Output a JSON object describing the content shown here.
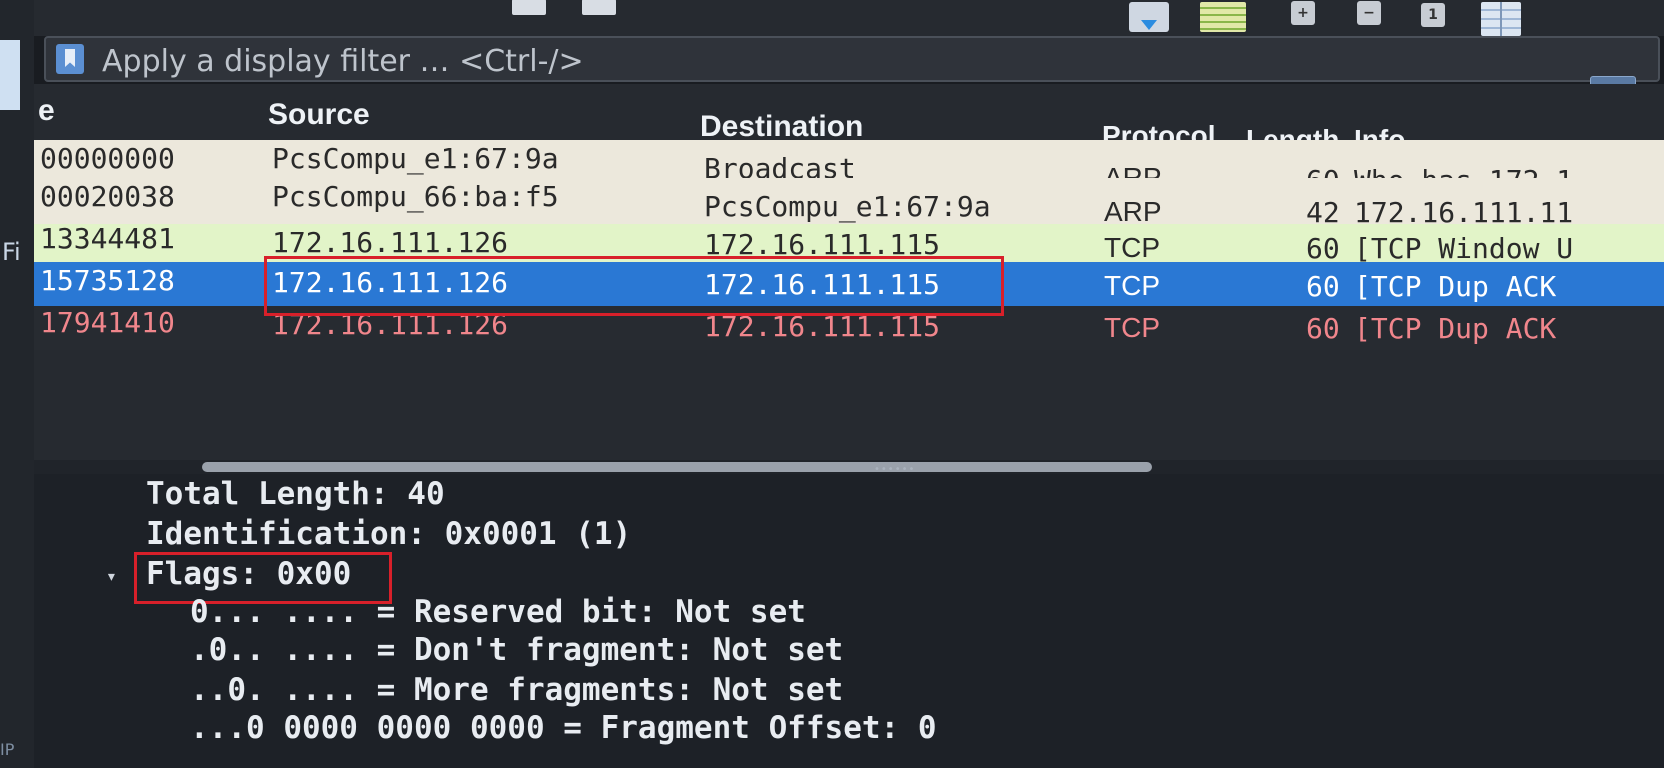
{
  "left_edge": {
    "fragment_top": "Fi",
    "fragment_bottom": "IP"
  },
  "toolbar": {
    "buttons": [
      {
        "name": "toolbar-button-1",
        "icon": "rect-icon"
      },
      {
        "name": "toolbar-button-2",
        "icon": "rect-icon"
      },
      {
        "name": "autoscroll-button",
        "icon": "document-down-icon"
      },
      {
        "name": "colorize-button",
        "icon": "lines-icon"
      },
      {
        "name": "zoom-in-button",
        "icon": "plus-icon",
        "glyph": "+"
      },
      {
        "name": "zoom-out-button",
        "icon": "minus-icon",
        "glyph": "−"
      },
      {
        "name": "normal-size-button",
        "icon": "one-icon",
        "glyph": "1"
      },
      {
        "name": "resize-columns-button",
        "icon": "columns-icon"
      }
    ]
  },
  "filter": {
    "placeholder": "Apply a display filter … <Ctrl-/>",
    "apply_glyph": "➡",
    "dropdown_glyph": "▾"
  },
  "packet_list": {
    "columns": {
      "time": "e",
      "source": "Source",
      "destination": "Destination",
      "protocol": "Protocol",
      "length": "Length",
      "info": "Info"
    },
    "rows": [
      {
        "time": "00000000",
        "source": "PcsCompu_e1:67:9a",
        "destination": "Broadcast",
        "protocol": "ARP",
        "length": "60",
        "info": "Who has 172.1"
      },
      {
        "time": "00020038",
        "source": "PcsCompu_66:ba:f5",
        "destination": "PcsCompu_e1:67:9a",
        "protocol": "ARP",
        "length": "42",
        "info": "172.16.111.11"
      },
      {
        "time": "13344481",
        "source": "172.16.111.126",
        "destination": "172.16.111.115",
        "protocol": "TCP",
        "length": "60",
        "info": "[TCP Window U"
      },
      {
        "time": "15735128",
        "source": "172.16.111.126",
        "destination": "172.16.111.115",
        "protocol": "TCP",
        "length": "60",
        "info": "[TCP Dup ACK"
      },
      {
        "time": "17941410",
        "source": "172.16.111.126",
        "destination": "172.16.111.115",
        "protocol": "TCP",
        "length": "60",
        "info": "[TCP Dup ACK"
      }
    ],
    "selected_row": 3
  },
  "splitter": {
    "grip": "••••••"
  },
  "details": {
    "lines": [
      "Total Length: 40",
      "Identification: 0x0001 (1)",
      "Flags: 0x00",
      "0... .... = Reserved bit: Not set",
      ".0.. .... = Don't fragment: Not set",
      "..0. .... = More fragments: Not set",
      "...0 0000 0000 0000 = Fragment Offset: 0"
    ],
    "expand_glyph": "▾"
  },
  "colors": {
    "arp_row": "#ece8dc",
    "tcp_row": "#e2f4c8",
    "selected_row": "#2a78d4",
    "bad_row_text": "#f0868c",
    "annotation_box": "#d8202a"
  }
}
